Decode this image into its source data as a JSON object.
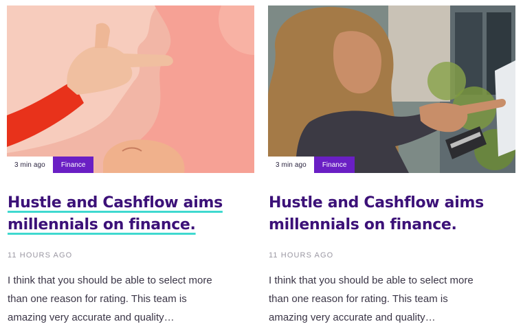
{
  "cards": [
    {
      "image": "illustration of a hand pointing a finger on a pink background",
      "time_ago": "3 min ago",
      "category": "Finance",
      "title": "Hustle and Cashflow aims millennials on finance.",
      "date": "11 HOURS AGO",
      "excerpt": "I think that you should be able to select more than one reason for rating. This team is amazing very accurate and quality…"
    },
    {
      "image": "woman with curly hair holding a credit card and pointing at a screen",
      "time_ago": "3 min ago",
      "category": "Finance",
      "title": "Hustle and Cashflow aims millennials on finance.",
      "date": "11 HOURS AGO",
      "excerpt": "I think that you should be able to select more than one reason for rating. This team is amazing very accurate and quality…"
    }
  ],
  "colors": {
    "title": "#3c1178",
    "category_chip": "#6a1fc4",
    "hover_underline": "#3fd9cf",
    "date": "#9a97a2",
    "body_text": "#3a3546"
  }
}
